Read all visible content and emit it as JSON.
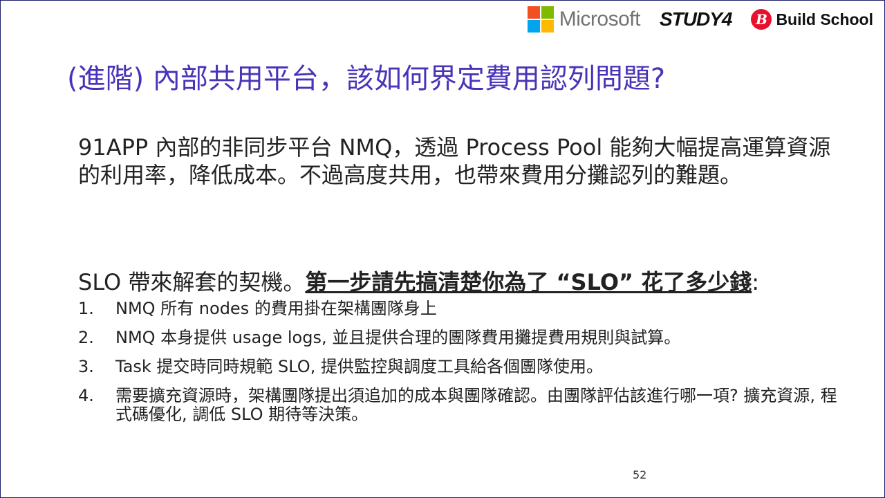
{
  "logos": {
    "microsoft": "Microsoft",
    "study4": "STUDY4",
    "buildschool_letter": "B",
    "buildschool": "Build School",
    "ms_colors": [
      "#f25022",
      "#7fba00",
      "#00a4ef",
      "#ffb900"
    ]
  },
  "title": "(進階) 內部共用平台，該如何界定費用認列問題?",
  "intro": "91APP 內部的非同步平台 NMQ，透過 Process Pool 能夠大幅提高運算資源的利用率，降低成本。不過高度共用，也帶來費用分攤認列的難題。",
  "slo_prefix": "SLO 帶來解套的契機。",
  "slo_emphasis": "第一步請先搞清楚你為了 “SLO” 花了多少錢",
  "slo_suffix": ":",
  "list": [
    {
      "num": "1.",
      "text": "NMQ 所有 nodes 的費用掛在架構團隊身上"
    },
    {
      "num": "2.",
      "text": "NMQ 本身提供 usage logs, 並且提供合理的團隊費用攤提費用規則與試算。"
    },
    {
      "num": "3.",
      "text": "Task 提交時同時規範 SLO, 提供監控與調度工具給各個團隊使用。"
    },
    {
      "num": "4.",
      "text": "需要擴充資源時，架構團隊提出須追加的成本與團隊確認。由團隊評估該進行哪一項? 擴充資源, 程式碼優化, 調低 SLO 期待等決策。"
    }
  ],
  "page_number": "52",
  "colors": {
    "title": "#4a33b8",
    "text": "#222222",
    "border": "#1f1f6e"
  }
}
